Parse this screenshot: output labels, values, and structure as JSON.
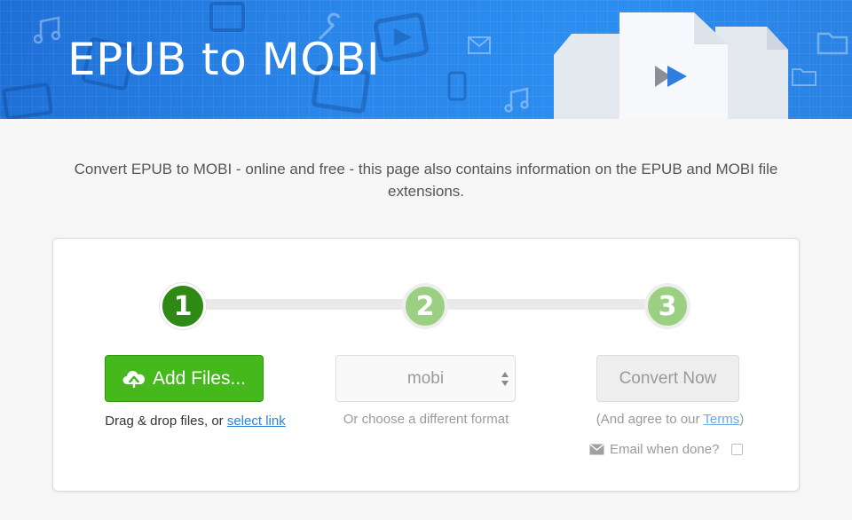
{
  "banner": {
    "title": "EPUB to MOBI"
  },
  "intro": {
    "text": "Convert EPUB to MOBI - online and free - this page also contains information on the EPUB and MOBI file extensions."
  },
  "steps": {
    "one": "1",
    "two": "2",
    "three": "3"
  },
  "upload": {
    "button_label": "Add Files...",
    "drag_text": "Drag & drop files, or ",
    "link_text": "select link"
  },
  "format": {
    "selected": "mobi",
    "hint": "Or choose a different format"
  },
  "convert": {
    "button_label": "Convert Now",
    "terms_prefix": "(And agree to our ",
    "terms_link": "Terms",
    "terms_suffix": ")",
    "email_label": "Email when done?"
  },
  "icons": {
    "upload": "cloud-upload-icon",
    "email": "envelope-icon",
    "select": "select-arrows-icon",
    "document": "document-icon",
    "play": "play-icon"
  },
  "colors": {
    "banner": "#2a86ea",
    "primary_green": "#45b81b",
    "step_active": "#2e8a14",
    "step_inactive": "#9bd083",
    "link": "#2f7fd8"
  }
}
